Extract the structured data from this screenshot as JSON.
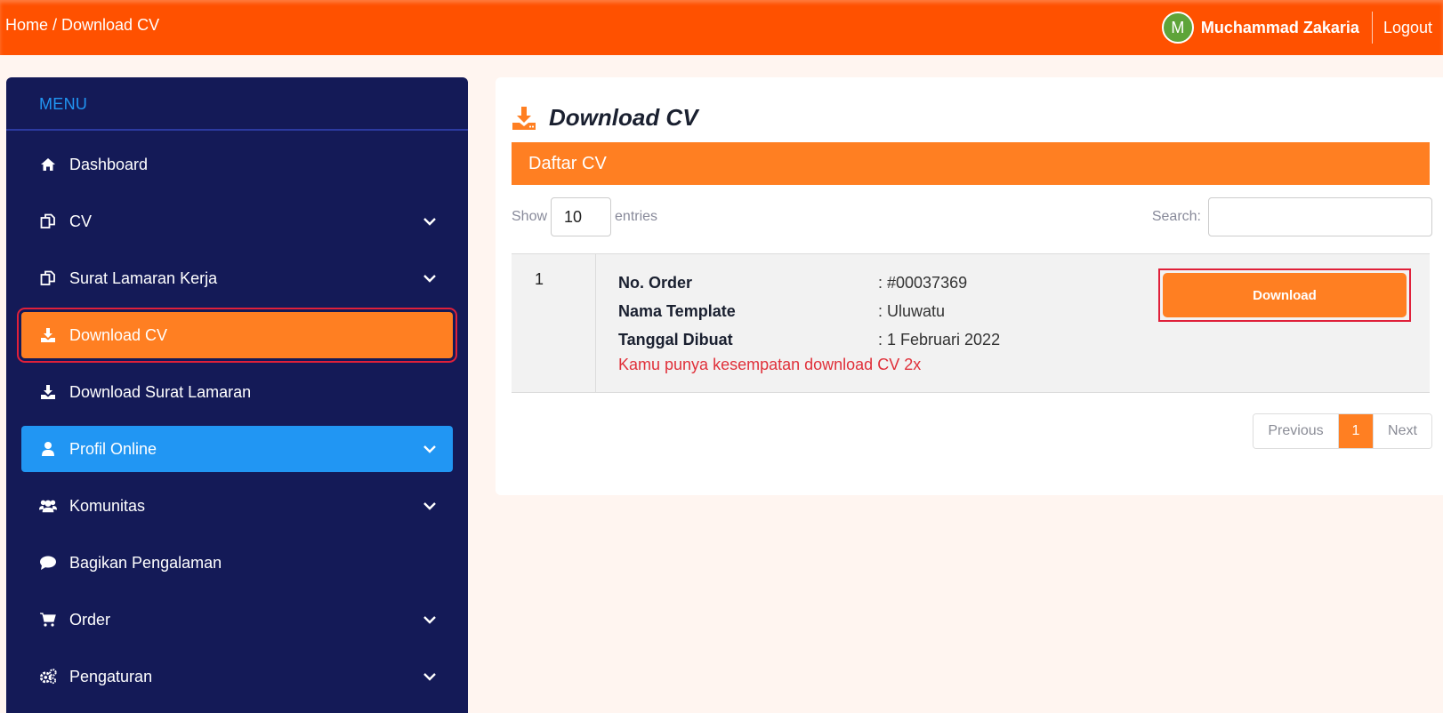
{
  "header": {
    "breadcrumb": "Home / Download CV",
    "avatar_letter": "M",
    "user_name": "Muchammad Zakaria",
    "logout_label": "Logout",
    "bar_color": "#ff5100"
  },
  "sidebar": {
    "title": "MENU",
    "items": [
      {
        "label": "Dashboard",
        "icon": "home-icon"
      },
      {
        "label": "CV",
        "icon": "copy-icon",
        "has_submenu": true
      },
      {
        "label": "Surat Lamaran Kerja",
        "icon": "copy-icon",
        "has_submenu": true
      },
      {
        "label": "Download CV",
        "icon": "download-icon",
        "active": true
      },
      {
        "label": "Download Surat Lamaran",
        "icon": "download-icon"
      },
      {
        "label": "Profil Online",
        "icon": "user-icon",
        "has_submenu": true,
        "highlighted": true
      },
      {
        "label": "Komunitas",
        "icon": "users-icon",
        "has_submenu": true
      },
      {
        "label": "Bagikan Pengalaman",
        "icon": "comment-icon"
      },
      {
        "label": "Order",
        "icon": "cart-icon",
        "has_submenu": true
      },
      {
        "label": "Pengaturan",
        "icon": "cogs-icon",
        "has_submenu": true
      }
    ]
  },
  "main": {
    "title": "Download CV",
    "title_icon": "download-icon",
    "section_title": "Daftar CV",
    "show_label": "Show",
    "entries_value": "10",
    "entries_label": "entries",
    "search_label": "Search:",
    "search_value": "",
    "rows": [
      {
        "number": "1",
        "order_label": "No. Order",
        "order_value": ": #00037369",
        "template_label": "Nama Template",
        "template_value": ": Uluwatu",
        "date_label": "Tanggal Dibuat",
        "date_value": ": 1 Februari 2022",
        "note": "Kamu punya kesempatan download CV 2x",
        "button_label": "Download"
      }
    ],
    "pagination": {
      "previous": "Previous",
      "current": "1",
      "next": "Next"
    }
  },
  "colors": {
    "accent_orange": "#ff7f22",
    "sidebar_bg": "#141a57",
    "highlight_blue": "#2196f3",
    "warning_red": "#e0303a"
  }
}
